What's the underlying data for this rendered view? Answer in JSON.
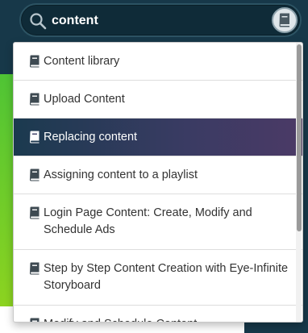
{
  "search": {
    "value": "content",
    "icon": "search-icon",
    "book_icon": "book-icon"
  },
  "colors": {
    "header_bg": "#173849",
    "active_item_start": "#1b3a4f",
    "active_item_end": "#4b3a66",
    "accent_green": "#4fc435"
  },
  "results": [
    {
      "label": "Content library",
      "icon": "book-icon",
      "active": false
    },
    {
      "label": "Upload Content",
      "icon": "book-icon",
      "active": false
    },
    {
      "label": "Replacing content",
      "icon": "book-icon",
      "active": true
    },
    {
      "label": "Assigning content to a playlist",
      "icon": "book-icon",
      "active": false
    },
    {
      "label": "Login Page Content: Create, Modify and Schedule Ads",
      "icon": "book-icon",
      "active": false
    },
    {
      "label": "Step by Step Content Creation with Eye-Infinite Storyboard",
      "icon": "book-icon",
      "active": false
    },
    {
      "label": "Modify and Schedule Content",
      "icon": "book-icon",
      "active": false
    }
  ]
}
